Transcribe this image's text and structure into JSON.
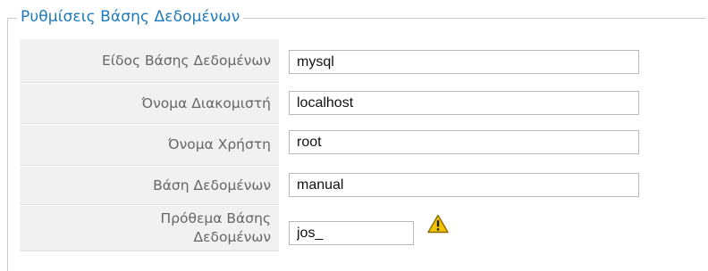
{
  "settings": {
    "legend": "Ρυθμίσεις Βάσης Δεδομένων",
    "fields": [
      {
        "label": "Είδος Βάσης Δεδομένων",
        "value": "mysql"
      },
      {
        "label": "Όνομα Διακομιστή",
        "value": "localhost"
      },
      {
        "label": "Όνομα Χρήστη",
        "value": "root"
      },
      {
        "label": "Βάση Δεδομένων",
        "value": "manual"
      },
      {
        "label_line1": "Πρόθεμα Βάσης",
        "label_line2": "Δεδομένων",
        "value": "jos_"
      }
    ],
    "warning_icon": "warning-triangle-icon",
    "colors": {
      "legend": "#1d79b8",
      "label_bg": "#f1f1f1",
      "warning": "#f3c400"
    }
  }
}
